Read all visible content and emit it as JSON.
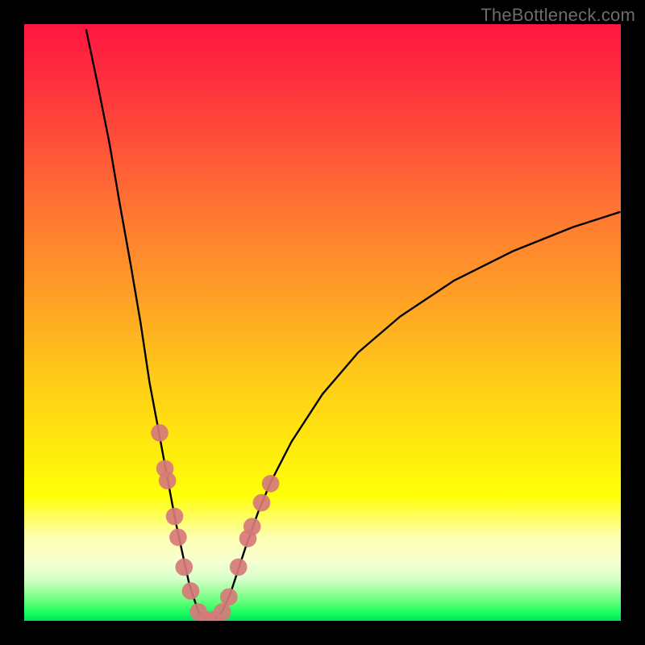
{
  "watermark": "TheBottleneck.com",
  "colors": {
    "curve": "#000000",
    "marker_fill": "#d67a7a",
    "marker_stroke": "#c05858",
    "gradient_top": "#ff1540",
    "gradient_bottom": "#00e25a",
    "frame": "#000000"
  },
  "chart_data": {
    "type": "line",
    "title": "",
    "xlabel": "",
    "ylabel": "",
    "xlim": [
      0,
      100
    ],
    "ylim": [
      0,
      100
    ],
    "series": [
      {
        "name": "bottleneck-curve",
        "data": [
          {
            "x": 10.4,
            "y": 99.0
          },
          {
            "x": 12.3,
            "y": 90.0
          },
          {
            "x": 14.3,
            "y": 80.0
          },
          {
            "x": 16.0,
            "y": 70.0
          },
          {
            "x": 17.8,
            "y": 60.0
          },
          {
            "x": 19.5,
            "y": 50.0
          },
          {
            "x": 21.0,
            "y": 40.0
          },
          {
            "x": 22.6,
            "y": 31.5
          },
          {
            "x": 23.8,
            "y": 25.0
          },
          {
            "x": 25.4,
            "y": 16.5
          },
          {
            "x": 26.6,
            "y": 11.0
          },
          {
            "x": 27.7,
            "y": 6.0
          },
          {
            "x": 29.2,
            "y": 1.5
          },
          {
            "x": 30.5,
            "y": 0.2
          },
          {
            "x": 31.8,
            "y": 0.2
          },
          {
            "x": 33.2,
            "y": 1.5
          },
          {
            "x": 34.7,
            "y": 5.0
          },
          {
            "x": 37.0,
            "y": 12.0
          },
          {
            "x": 39.2,
            "y": 18.2
          },
          {
            "x": 41.3,
            "y": 23.2
          },
          {
            "x": 44.8,
            "y": 30.0
          },
          {
            "x": 50.0,
            "y": 38.0
          },
          {
            "x": 56.0,
            "y": 45.0
          },
          {
            "x": 63.0,
            "y": 51.0
          },
          {
            "x": 72.0,
            "y": 57.0
          },
          {
            "x": 82.0,
            "y": 62.0
          },
          {
            "x": 92.0,
            "y": 66.0
          },
          {
            "x": 99.8,
            "y": 68.5
          }
        ]
      },
      {
        "name": "markers",
        "data": [
          {
            "x": 22.7,
            "y": 31.5
          },
          {
            "x": 23.6,
            "y": 25.5
          },
          {
            "x": 24.0,
            "y": 23.5
          },
          {
            "x": 25.2,
            "y": 17.5
          },
          {
            "x": 25.8,
            "y": 14.0
          },
          {
            "x": 26.8,
            "y": 9.0
          },
          {
            "x": 27.9,
            "y": 5.0
          },
          {
            "x": 29.2,
            "y": 1.5
          },
          {
            "x": 30.5,
            "y": 0.2
          },
          {
            "x": 31.8,
            "y": 0.2
          },
          {
            "x": 33.2,
            "y": 1.5
          },
          {
            "x": 34.3,
            "y": 4.0
          },
          {
            "x": 35.9,
            "y": 9.0
          },
          {
            "x": 37.5,
            "y": 13.8
          },
          {
            "x": 38.2,
            "y": 15.8
          },
          {
            "x": 39.8,
            "y": 19.8
          },
          {
            "x": 41.3,
            "y": 23.0
          }
        ]
      }
    ]
  }
}
